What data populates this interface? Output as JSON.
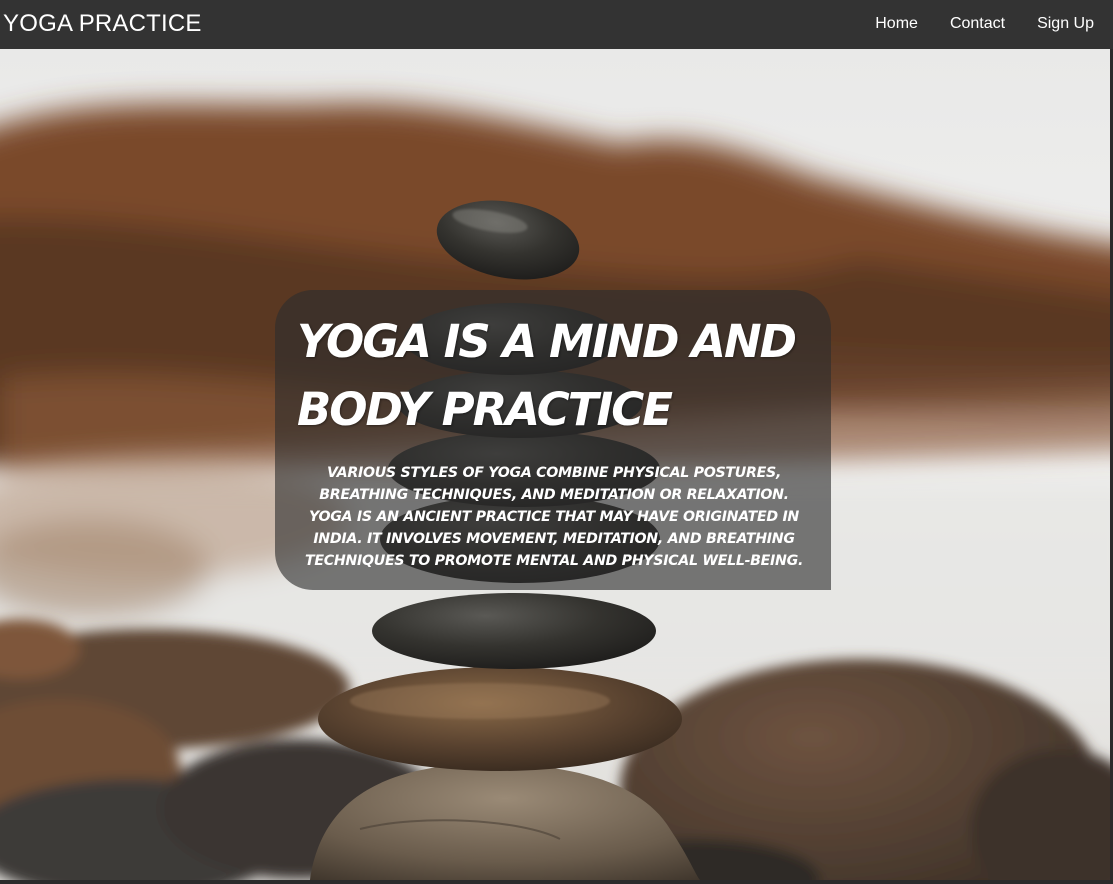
{
  "navbar": {
    "brand": "YOGA PRACTICE",
    "links": [
      {
        "label": "Home"
      },
      {
        "label": "Contact"
      },
      {
        "label": "Sign Up"
      }
    ]
  },
  "hero": {
    "background_image": "stacked-stones-on-beach",
    "title": "YOGA IS A MIND AND BODY PRACTICE",
    "description": "VARIOUS STYLES OF YOGA COMBINE PHYSICAL POSTURES, BREATHING TECHNIQUES, AND MEDITATION OR RELAXATION. YOGA IS AN ANCIENT PRACTICE THAT MAY HAVE ORIGINATED IN INDIA. IT INVOLVES MOVEMENT, MEDITATION, AND BREATHING TECHNIQUES TO PROMOTE MENTAL AND PHYSICAL WELL-BEING."
  },
  "colors": {
    "navbar_bg": "#333333",
    "nav_text": "#ffffff",
    "card_bg": "#2d2d2d",
    "stone_dark": "#2e2d2b",
    "rock_brown": "#7a4a2a"
  }
}
